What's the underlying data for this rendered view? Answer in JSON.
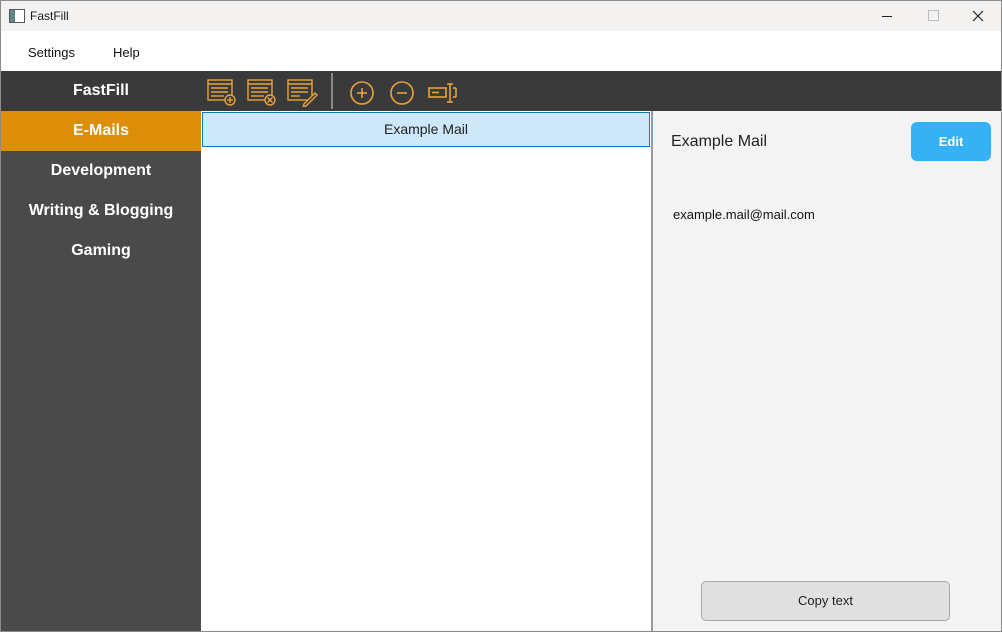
{
  "window": {
    "title": "FastFill",
    "controls": [
      "minimize-icon",
      "maximize-icon",
      "close-icon"
    ]
  },
  "menu": {
    "items": [
      {
        "label": "Settings"
      },
      {
        "label": "Help"
      }
    ]
  },
  "sidebar": {
    "brand": "FastFill",
    "categories": [
      {
        "label": "E-Mails",
        "active": true
      },
      {
        "label": "Development",
        "active": false
      },
      {
        "label": "Writing & Blogging",
        "active": false
      },
      {
        "label": "Gaming",
        "active": false
      }
    ]
  },
  "toolbar": {
    "icons": [
      "add-category-icon",
      "remove-category-icon",
      "edit-category-icon",
      "add-item-icon",
      "remove-item-icon",
      "rename-item-icon"
    ],
    "accent_color": "#e8a23a"
  },
  "list": {
    "items": [
      {
        "label": "Example Mail",
        "selected": true
      }
    ]
  },
  "detail": {
    "title": "Example Mail",
    "edit_label": "Edit",
    "content": "example.mail@mail.com",
    "copy_label": "Copy text"
  },
  "colors": {
    "active_category": "#dc8e06",
    "edit_button": "#34b2f5",
    "selected_row": "#cde8fb",
    "sidebar_bg": "#4a4a4a",
    "toolbar_bg": "#3a3a3a"
  }
}
